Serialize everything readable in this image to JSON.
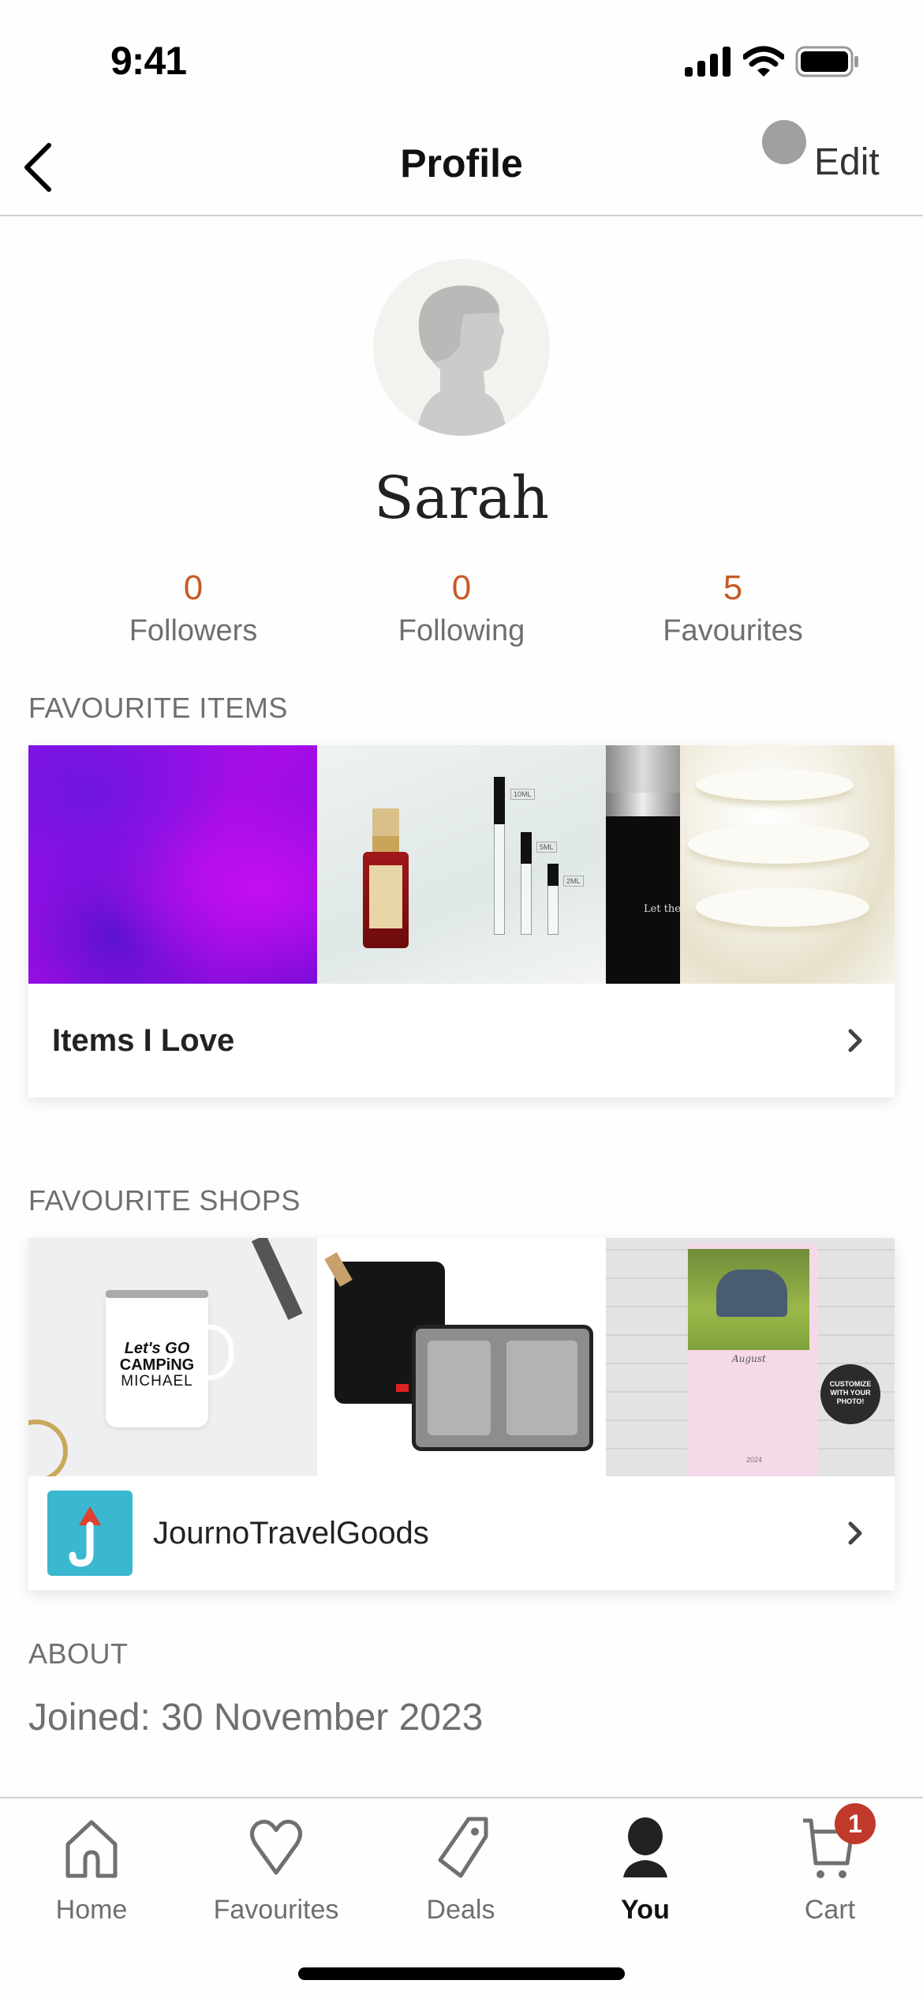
{
  "status_bar": {
    "time": "9:41"
  },
  "nav": {
    "title": "Profile",
    "edit_label": "Edit"
  },
  "profile": {
    "name": "Sarah"
  },
  "stats": [
    {
      "value": "0",
      "label": "Followers"
    },
    {
      "value": "0",
      "label": "Following"
    },
    {
      "value": "5",
      "label": "Favourites"
    }
  ],
  "favourite_items": {
    "section_label": "FAVOURITE ITEMS",
    "collection_title": "Items I Love",
    "images": [
      "purple-abstract-image",
      "perfume-bottles-image",
      "roll-on-perfume-image",
      "whipped-cream-image"
    ],
    "image_text": {
      "perfume_sizes": [
        "10ML",
        "5ML",
        "2ML"
      ],
      "rollon_text": "Let the Sc"
    }
  },
  "favourite_shops": {
    "section_label": "FAVOURITE SHOPS",
    "shop_name": "JournoTravelGoods",
    "shop_logo_letter": "J",
    "images": [
      "camping-mug-image",
      "travel-organizer-image",
      "photo-calendar-image"
    ],
    "image_text": {
      "mug": [
        "Let's GO",
        "CAMPiNG",
        "MICHAEL"
      ],
      "calendar_month": "August",
      "calendar_year": "2024",
      "calendar_badge": [
        "CUSTOMIZE",
        "WITH YOUR",
        "PHOTO!"
      ]
    }
  },
  "about": {
    "section_label": "ABOUT",
    "joined": "Joined: 30 November 2023"
  },
  "tab_bar": {
    "tabs": [
      {
        "label": "Home",
        "icon": "home-icon"
      },
      {
        "label": "Favourites",
        "icon": "heart-icon"
      },
      {
        "label": "Deals",
        "icon": "tag-icon"
      },
      {
        "label": "You",
        "icon": "person-icon",
        "active": true
      },
      {
        "label": "Cart",
        "icon": "cart-icon",
        "badge": "1"
      }
    ]
  },
  "colors": {
    "accent": "#c75a26",
    "badge": "#c0392b",
    "shop_logo_bg": "#3bb7cf"
  }
}
